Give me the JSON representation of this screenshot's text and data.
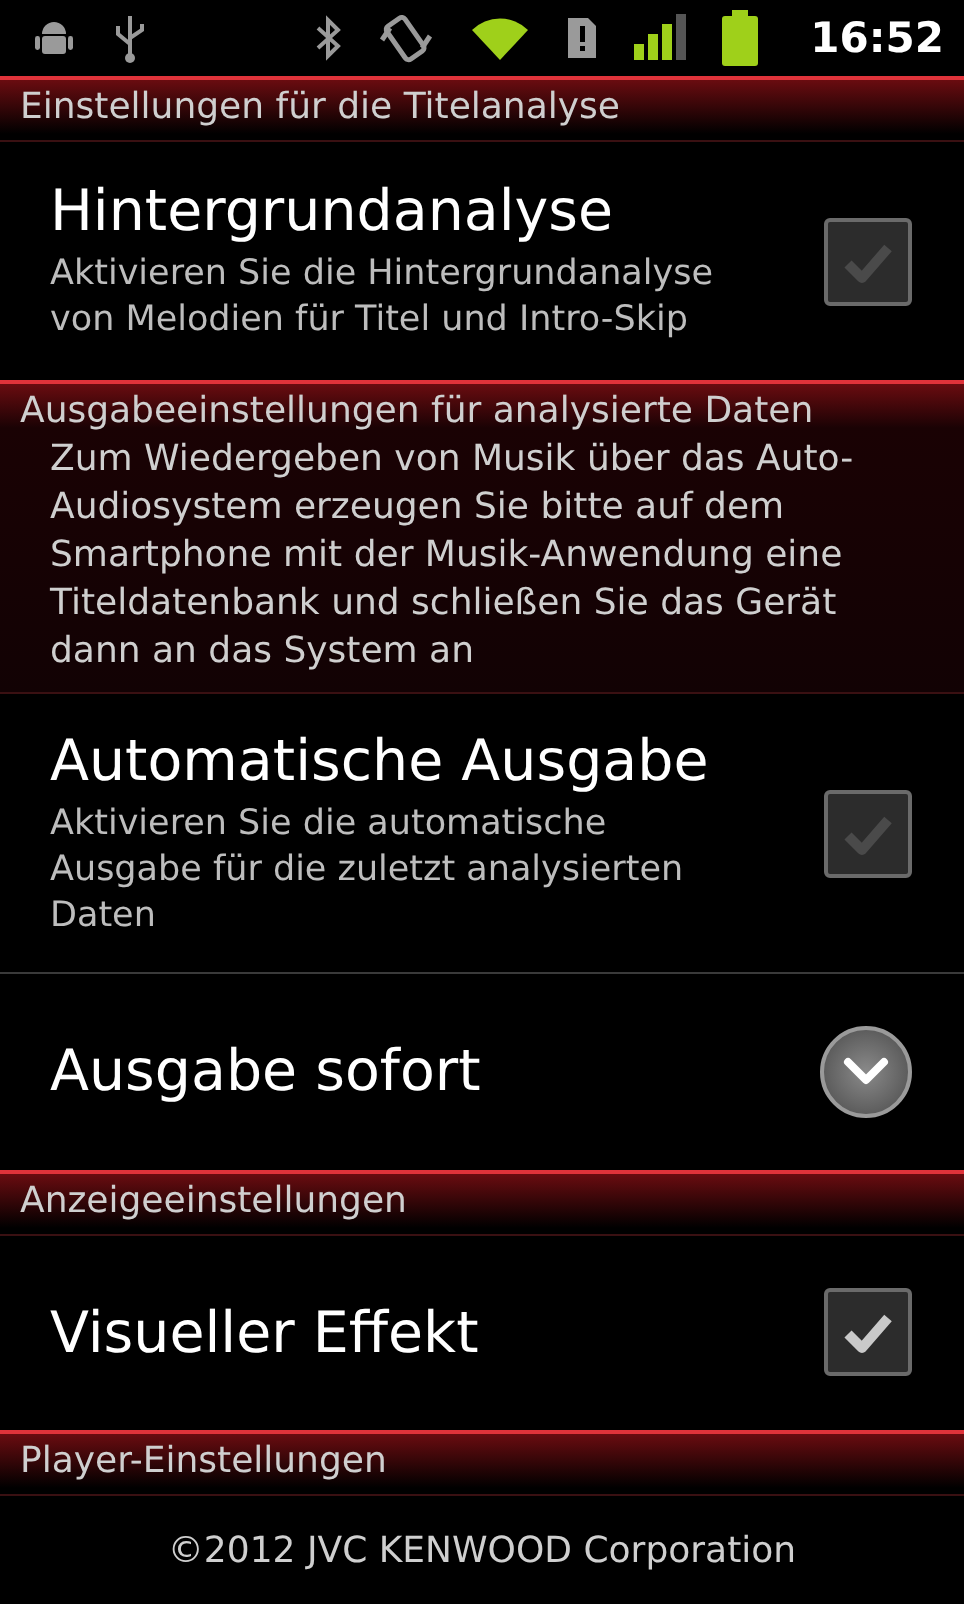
{
  "status_bar": {
    "time": "16:52"
  },
  "sections": [
    {
      "header": "Einstellungen für die Titelanalyse",
      "items": [
        {
          "kind": "checkbox",
          "title": "Hintergrundanalyse",
          "summary": "Aktivieren Sie die Hintergrundanalyse von Melodien für Titel und Intro-Skip",
          "checked": false
        }
      ]
    },
    {
      "header": "Ausgabeeinstellungen für analysierte Daten",
      "description": "Zum Wiedergeben von Musik über das Auto-Audiosystem erzeugen Sie bitte auf dem Smartphone mit der Musik-Anwendung eine Titeldatenbank und schließen Sie das Gerät dann an das System an",
      "items": [
        {
          "kind": "checkbox",
          "title": "Automatische Ausgabe",
          "summary": "Aktivieren Sie die automatische Ausgabe für die zuletzt analysierten Daten",
          "checked": false
        },
        {
          "kind": "dropdown",
          "title": "Ausgabe sofort"
        }
      ]
    },
    {
      "header": "Anzeigeeinstellungen",
      "items": [
        {
          "kind": "checkbox",
          "title": "Visueller Effekt",
          "checked": true
        }
      ]
    },
    {
      "header": "Player-Einstellungen"
    }
  ],
  "footer": "©2012 JVC KENWOOD Corporation"
}
